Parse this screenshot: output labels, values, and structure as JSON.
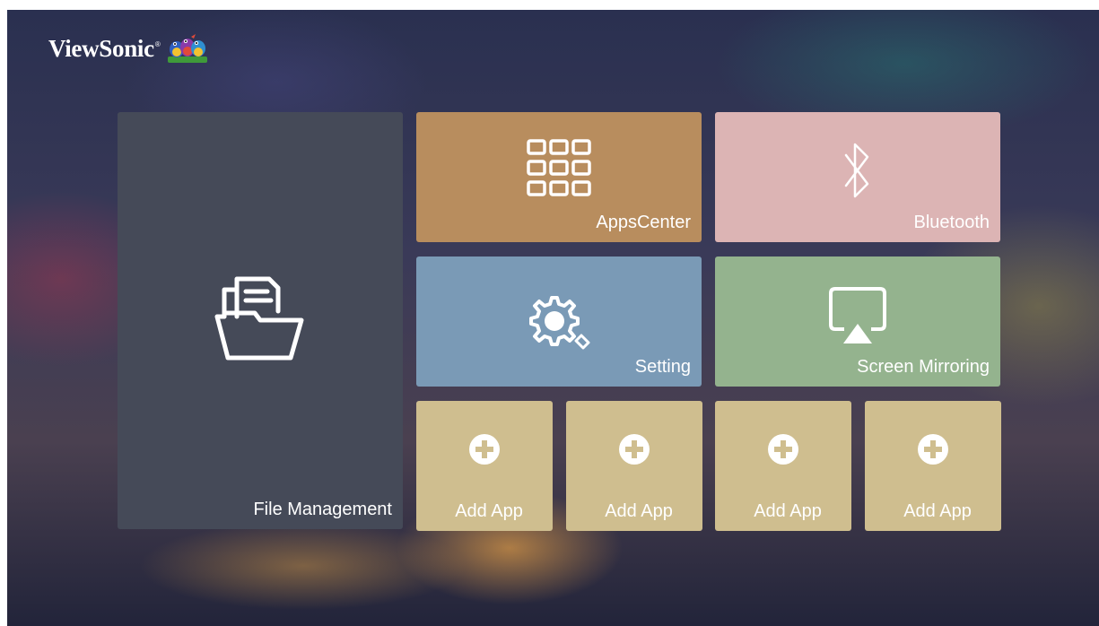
{
  "brand": {
    "name": "ViewSonic",
    "registered_mark": "®"
  },
  "tiles": {
    "file_management": {
      "label": "File Management",
      "icon": "folder-documents-icon"
    },
    "apps_center": {
      "label": "AppsCenter",
      "icon": "apps-grid-icon"
    },
    "bluetooth": {
      "label": "Bluetooth",
      "icon": "bluetooth-icon"
    },
    "setting": {
      "label": "Setting",
      "icon": "gear-icon"
    },
    "screen_mirroring": {
      "label": "Screen Mirroring",
      "icon": "screen-mirror-icon"
    },
    "add_apps": [
      {
        "label": "Add App",
        "icon": "plus-circle-icon"
      },
      {
        "label": "Add App",
        "icon": "plus-circle-icon"
      },
      {
        "label": "Add App",
        "icon": "plus-circle-icon"
      },
      {
        "label": "Add App",
        "icon": "plus-circle-icon"
      }
    ]
  },
  "colors": {
    "file_management": "#454a58",
    "apps_center": "#b88d5e",
    "bluetooth": "#dcb4b4",
    "setting": "#7a9ab6",
    "screen_mirroring": "#94b38e",
    "add_app": "#cfbe8f"
  }
}
